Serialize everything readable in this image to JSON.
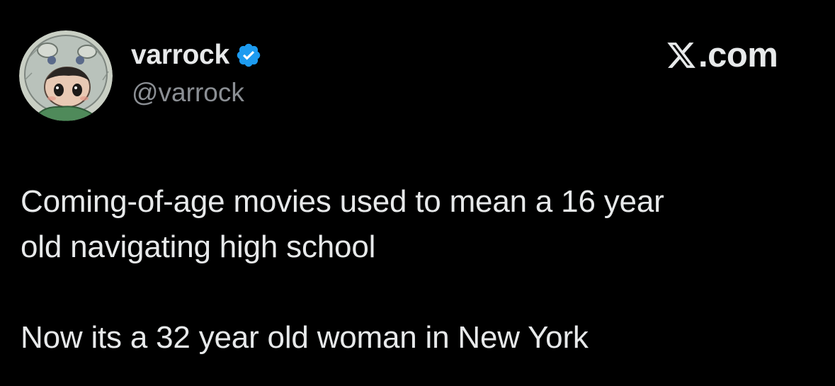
{
  "author": {
    "display_name": "varrock",
    "handle": "@varrock",
    "verified": true,
    "avatar_icon": "avatar-image",
    "verified_icon": "verified-badge-icon",
    "verified_color": "#1d9bf0"
  },
  "brand": {
    "icon": "x-logo-icon",
    "label": ".com"
  },
  "tweet": {
    "text": "Coming-of-age movies used to mean a 16 year\nold navigating high school\n\nNow its a 32 year old woman in New York"
  },
  "colors": {
    "background": "#000000",
    "primary_text": "#e7e9ea",
    "secondary_text": "#8b8f94"
  }
}
